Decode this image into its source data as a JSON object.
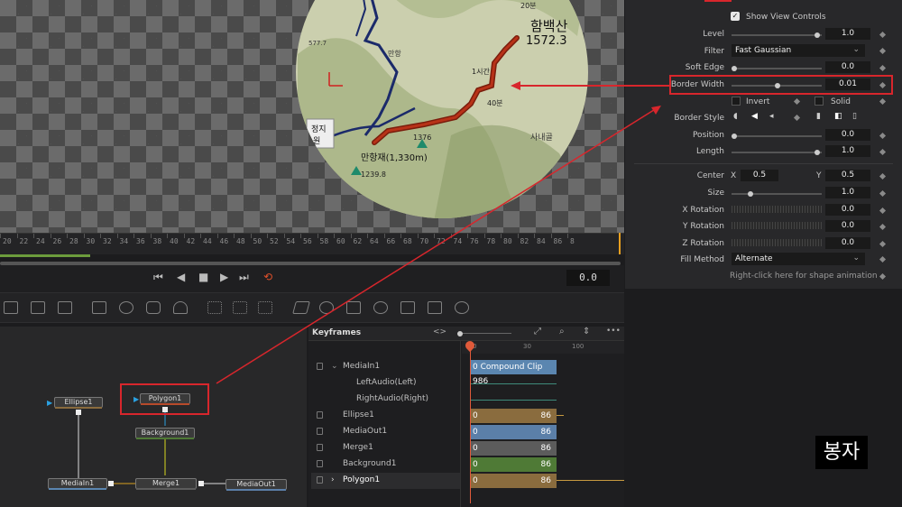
{
  "ruler": {
    "ticks": [
      "20",
      "22",
      "24",
      "26",
      "28",
      "30",
      "32",
      "34",
      "36",
      "38",
      "40",
      "42",
      "44",
      "46",
      "48",
      "50",
      "52",
      "54",
      "56",
      "58",
      "60",
      "62",
      "64",
      "66",
      "68",
      "70",
      "72",
      "74",
      "76",
      "78",
      "80",
      "82",
      "84",
      "86",
      "8"
    ]
  },
  "transport": {
    "timecode": "0.0"
  },
  "map": {
    "peak_name": "함백산",
    "peak_height": "1572.3",
    "pass_label": "만항재(1,330m)",
    "labels": [
      "20분",
      "1시간",
      "40분",
      "1376",
      "1239.8",
      "사내골",
      "만항",
      "577.7",
      "정지",
      "원"
    ]
  },
  "inspector": {
    "show_view_controls": "Show View Controls",
    "rows": [
      {
        "label": "Level",
        "value": "1.0"
      },
      {
        "label": "Filter",
        "value": "Fast Gaussian"
      },
      {
        "label": "Soft Edge",
        "value": "0.0"
      },
      {
        "label": "Border Width",
        "value": "0.01"
      },
      {
        "label": "Border Style",
        "value": ""
      },
      {
        "label": "Position",
        "value": "0.0"
      },
      {
        "label": "Length",
        "value": "1.0"
      },
      {
        "label": "Center",
        "value": ""
      },
      {
        "label": "Size",
        "value": "1.0"
      },
      {
        "label": "X Rotation",
        "value": "0.0"
      },
      {
        "label": "Y Rotation",
        "value": "0.0"
      },
      {
        "label": "Z Rotation",
        "value": "0.0"
      },
      {
        "label": "Fill Method",
        "value": "Alternate"
      }
    ],
    "invert": "Invert",
    "solid": "Solid",
    "center_x_label": "X",
    "center_x": "0.5",
    "center_y_label": "Y",
    "center_y": "0.5",
    "hint": "Right-click here for shape animation"
  },
  "keyframes": {
    "title": "Keyframes",
    "scale": [
      "0",
      "30",
      "100"
    ],
    "rows": [
      {
        "name": "MediaIn1",
        "bar": "0 Compound Clip 986",
        "color": "#5b86b0"
      },
      {
        "name": "LeftAudio(Left)",
        "bar": "",
        "color": ""
      },
      {
        "name": "RightAudio(Right)",
        "bar": "",
        "color": ""
      },
      {
        "name": "Ellipse1",
        "start": "0",
        "end": "86",
        "color": "#8a6c3e"
      },
      {
        "name": "MediaOut1",
        "start": "0",
        "end": "86",
        "color": "#5b7fa8"
      },
      {
        "name": "Merge1",
        "start": "0",
        "end": "86",
        "color": "#5c5c5c"
      },
      {
        "name": "Background1",
        "start": "0",
        "end": "86",
        "color": "#4f7a36"
      },
      {
        "name": "Polygon1",
        "start": "0",
        "end": "86",
        "color": "#8a6c3e"
      }
    ]
  },
  "nodes": {
    "ellipse": "Ellipse1",
    "polygon": "Polygon1",
    "background": "Background1",
    "mediain": "MediaIn1",
    "merge": "Merge1",
    "mediaout": "MediaOut1"
  },
  "badge": "봉자",
  "colors": {
    "accent_red": "#d8262c",
    "playhead": "#e05a3a"
  }
}
